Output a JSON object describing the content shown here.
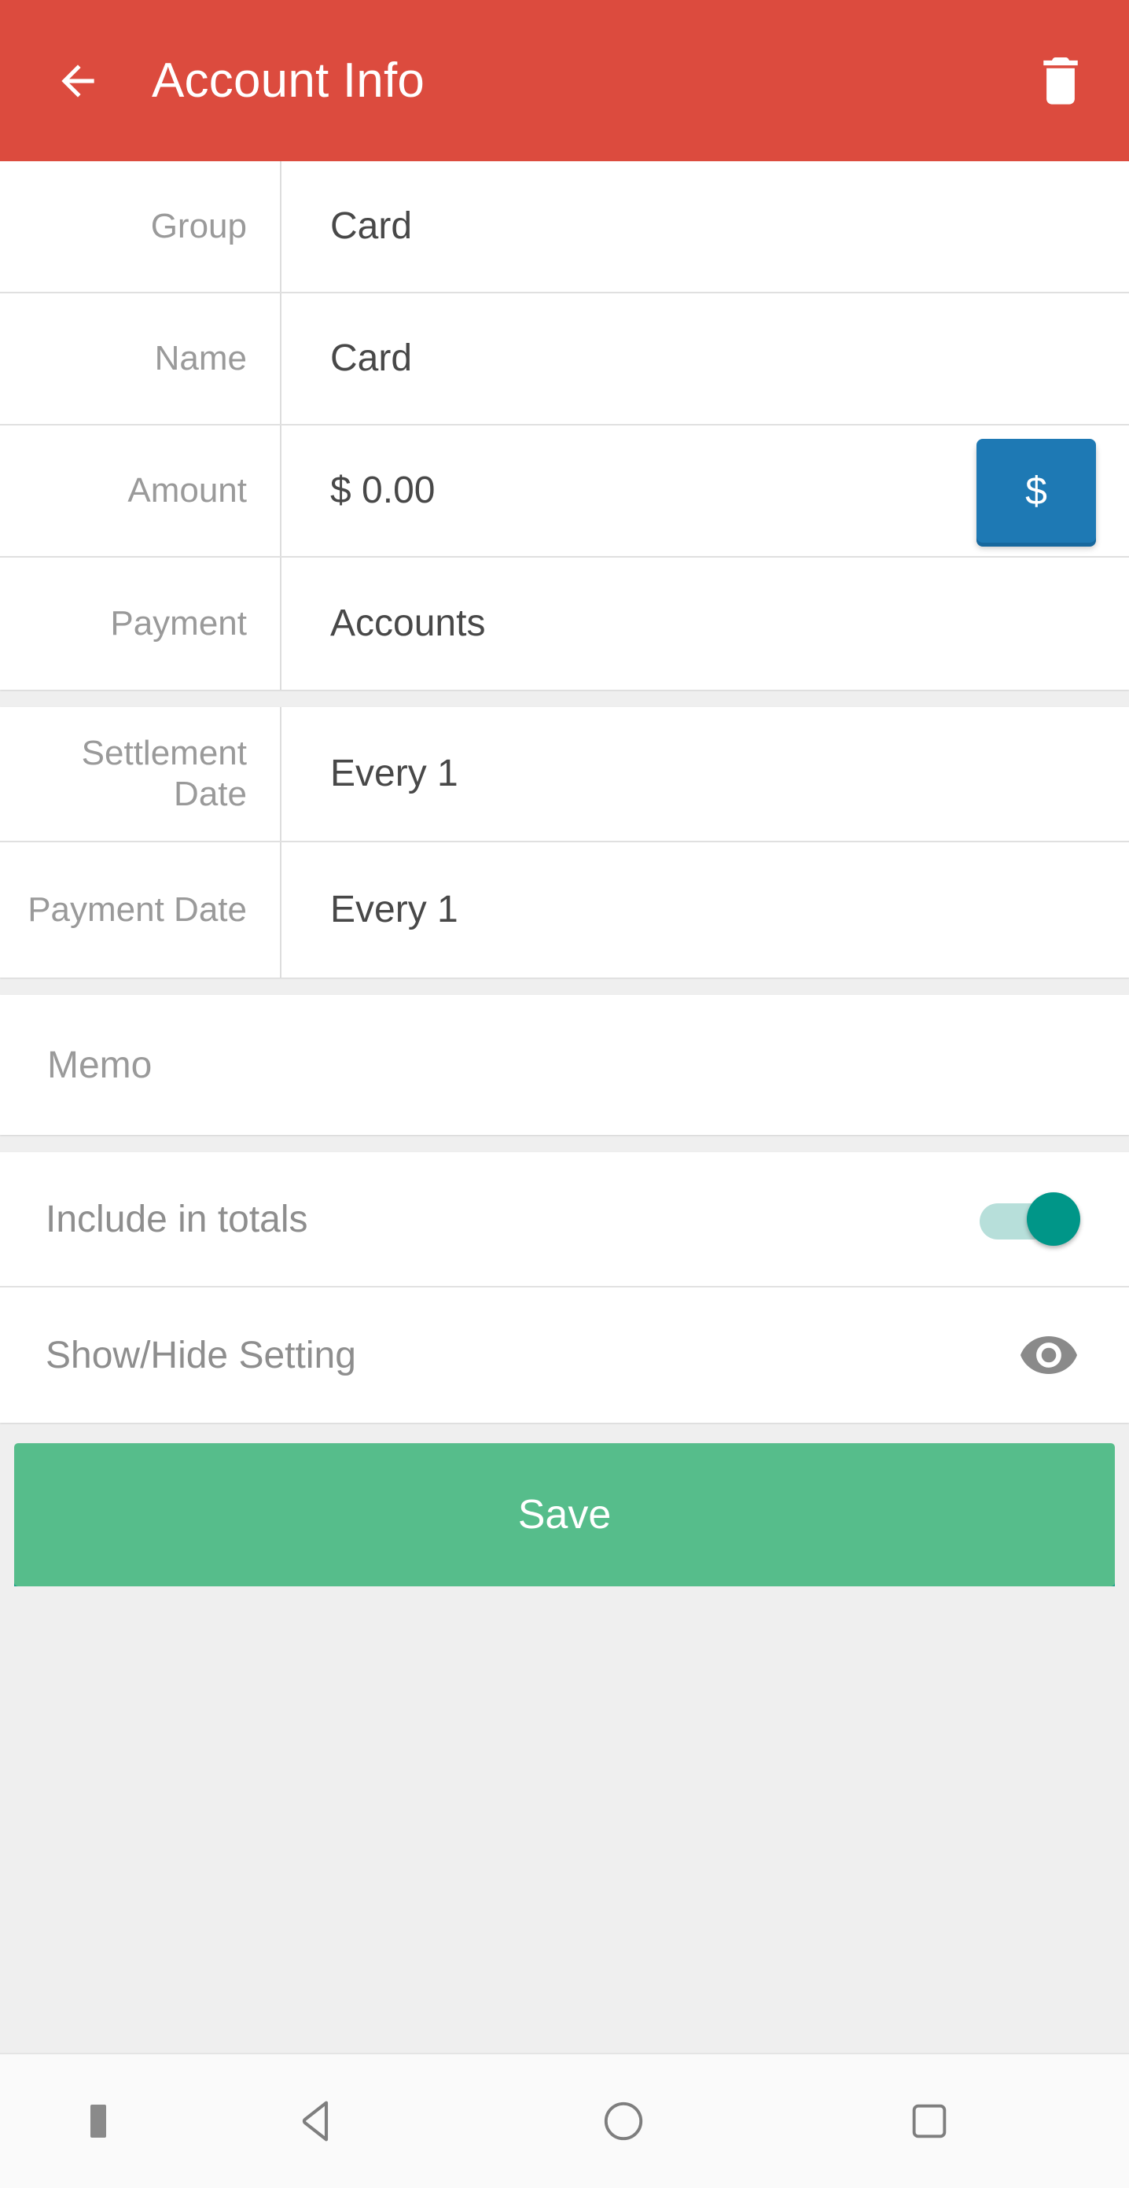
{
  "appbar": {
    "back_icon": "arrow-left-icon",
    "title": "Account Info",
    "delete_icon": "trash-icon",
    "background_color": "#DC4B3E",
    "text_color": "#FFFFFF"
  },
  "form": {
    "section_main": [
      {
        "label": "Group",
        "value": "Card"
      },
      {
        "label": "Name",
        "value": "Card"
      },
      {
        "label": "Amount",
        "value": "$ 0.00",
        "action_button": {
          "label": "$",
          "name": "currency-button",
          "color": "#1E79B4"
        }
      },
      {
        "label": "Payment",
        "value": "Accounts"
      }
    ],
    "section_dates": [
      {
        "label": "Settlement Date",
        "value": "Every 1"
      },
      {
        "label": "Payment Date",
        "value": "Every 1"
      }
    ],
    "section_memo": {
      "placeholder": "Memo",
      "value": ""
    },
    "section_settings": [
      {
        "label": "Include in totals",
        "control": "toggle",
        "state": "on",
        "accent_color": "#009688"
      },
      {
        "label": "Show/Hide Setting",
        "control": "eye-icon",
        "state": "visible",
        "icon_color": "#8A8A8A"
      }
    ]
  },
  "actions": {
    "save_label": "Save",
    "save_color": "#56BD8B",
    "save_shadow_color": "#169D8A"
  },
  "navbar": {
    "dot": "menu-dot-indicator",
    "back": "nav-back-icon",
    "home": "nav-home-icon",
    "recents": "nav-recents-icon",
    "background_color": "#FAFAFA"
  },
  "theme": {
    "page_background": "#EFEFEF",
    "card_background": "#FFFFFF",
    "label_color": "#9A9A9A",
    "value_color": "#484848",
    "divider_color": "#E0E0E0"
  }
}
